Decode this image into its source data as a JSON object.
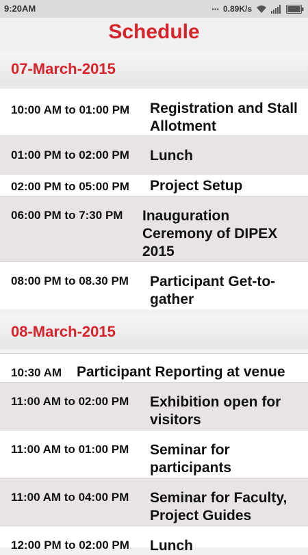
{
  "status_bar": {
    "time": "9:20AM",
    "network_speed": "0.89K/s",
    "icons": [
      "dots-icon",
      "wifi-icon",
      "signal-icon",
      "battery-icon"
    ]
  },
  "title": "Schedule",
  "days": [
    {
      "date": "07-March-2015",
      "events": [
        {
          "time": "10:00 AM to 01:00 PM",
          "name": "Registration and Stall Allotment"
        },
        {
          "time": "01:00 PM to 02:00 PM",
          "name": "Lunch"
        },
        {
          "time": "02:00 PM to 05:00 PM",
          "name": "Project Setup"
        },
        {
          "time": "06:00 PM to 7:30 PM",
          "name": "Inauguration Ceremony of DIPEX 2015"
        },
        {
          "time": "08:00 PM to 08.30 PM",
          "name": "Participant Get-to-gather"
        }
      ]
    },
    {
      "date": "08-March-2015",
      "events": [
        {
          "time": "10:30 AM",
          "name": "Participant Reporting at venue"
        },
        {
          "time": "11:00 AM to 02:00 PM",
          "name": "Exhibition open for visitors"
        },
        {
          "time": "11:00 AM to 01:00 PM",
          "name": "Seminar for participants"
        },
        {
          "time": "11:00 AM to 04:00 PM",
          "name": "Seminar for Faculty, Project Guides"
        },
        {
          "time": "12:00 PM to 02:00 PM",
          "name": "Lunch"
        }
      ]
    }
  ],
  "colors": {
    "accent": "#d9232a",
    "row_alt": "#e8e4e4",
    "row": "#ffffff"
  }
}
